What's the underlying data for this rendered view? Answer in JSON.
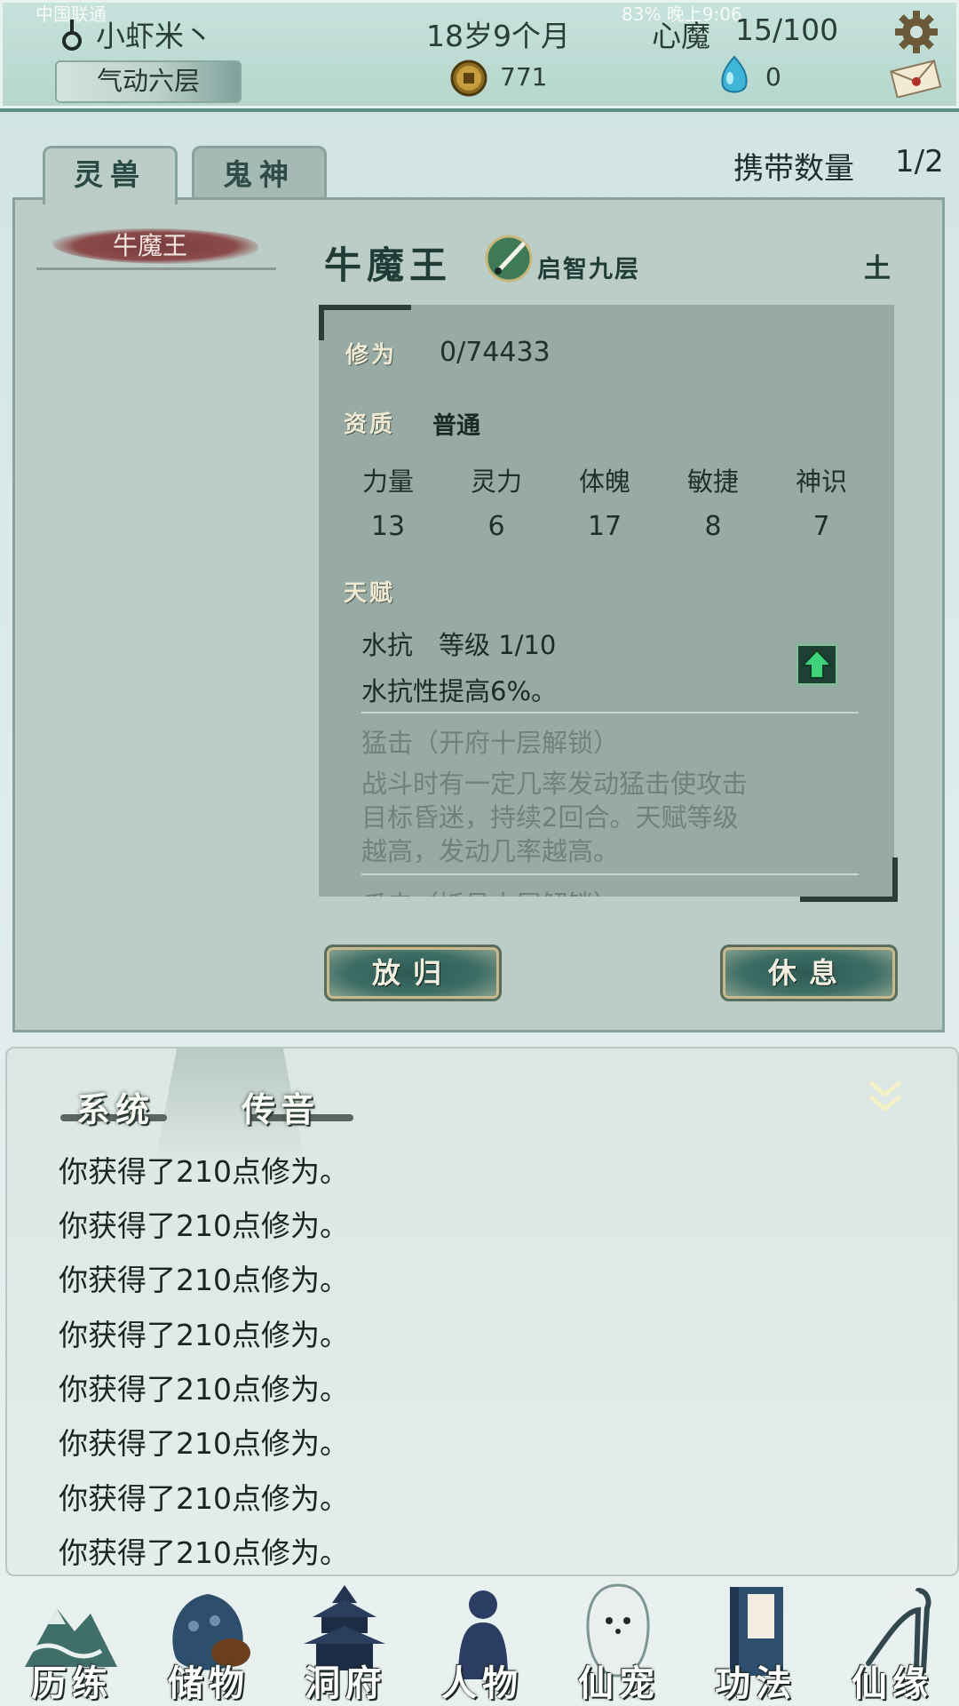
{
  "status_bar": {
    "carrier": "中国联通",
    "right": "83% 晚上9:06"
  },
  "header": {
    "player_name": "小虾米丶",
    "realm": "气动六层",
    "age": "18岁9个月",
    "xinmo_label": "心魔",
    "xinmo_value": "15/100",
    "coins": "771",
    "jade": "0",
    "icons": [
      "gourd-icon",
      "coin-icon",
      "jade-icon",
      "settings-gear-icon",
      "mail-icon"
    ]
  },
  "tabs": [
    {
      "label": "灵兽",
      "active": true
    },
    {
      "label": "鬼神",
      "active": false
    }
  ],
  "carry": {
    "label": "携带数量",
    "value": "1/2"
  },
  "pet_list": [
    "牛魔王"
  ],
  "pet": {
    "name": "牛魔王",
    "stage": "启智九层",
    "element": "土",
    "xiuwei_label": "修为",
    "xiuwei_value": "0/74433",
    "zizhi_label": "资质",
    "zizhi_value": "普通",
    "stats": [
      {
        "name": "力量",
        "value": "13"
      },
      {
        "name": "灵力",
        "value": "6"
      },
      {
        "name": "体魄",
        "value": "17"
      },
      {
        "name": "敏捷",
        "value": "8"
      },
      {
        "name": "神识",
        "value": "7"
      }
    ],
    "tianfu_label": "天赋",
    "talents": [
      {
        "title": "水抗　等级  1/10",
        "desc": "水抗性提高6%。"
      },
      {
        "title": "猛击（开府十层解锁）",
        "desc_lines": [
          "战斗时有一定几率发动猛击使攻击",
          "目标昏迷，持续2回合。天赋等级",
          "越高，发动几率越高。"
        ]
      },
      {
        "title": "爪击（妖丹十层解锁）"
      }
    ]
  },
  "actions": {
    "release": "放归",
    "rest": "休息"
  },
  "chat": {
    "tabs": [
      "系统",
      "传音"
    ],
    "messages": [
      "你获得了210点修为。",
      "你获得了210点修为。",
      "你获得了210点修为。",
      "你获得了210点修为。",
      "你获得了210点修为。",
      "你获得了210点修为。",
      "你获得了210点修为。",
      "你获得了210点修为。"
    ]
  },
  "nav": [
    {
      "label": "历练",
      "icon": "mountain-icon"
    },
    {
      "label": "储物",
      "icon": "bag-icon"
    },
    {
      "label": "洞府",
      "icon": "pagoda-icon"
    },
    {
      "label": "人物",
      "icon": "person-icon"
    },
    {
      "label": "仙宠",
      "icon": "ghost-pet-icon"
    },
    {
      "label": "功法",
      "icon": "book-icon"
    },
    {
      "label": "仙缘",
      "icon": "crane-icon"
    }
  ],
  "colors": {
    "panel": "#bccdc8",
    "detail_box": "#98aaa4",
    "header": "#b5d6cd",
    "button": "#3f6e66"
  }
}
